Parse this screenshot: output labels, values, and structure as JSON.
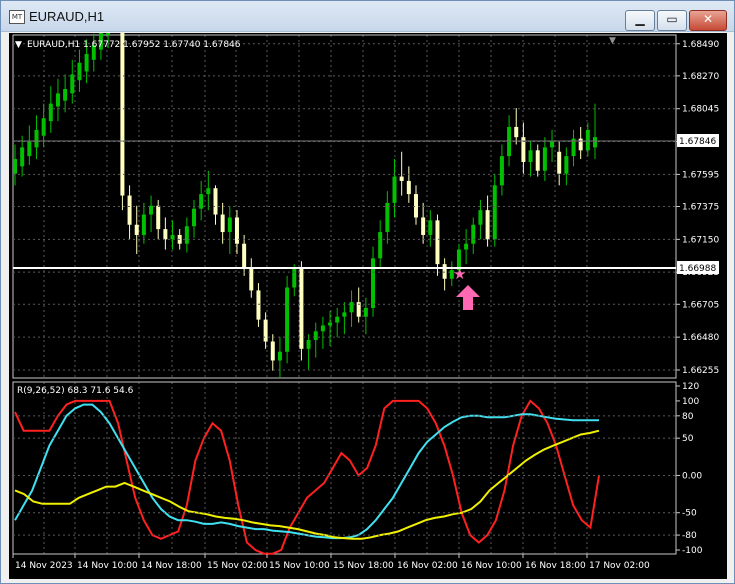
{
  "window": {
    "title": "EURAUD,H1",
    "icon_label": "MT",
    "minimize_glyph": "▁",
    "maximize_glyph": "▭",
    "close_glyph": "✕"
  },
  "price_panel": {
    "header": "EURAUD,H1  1.67772 1.67952 1.67740 1.67846",
    "y_ticks": [
      "1.68490",
      "1.68270",
      "1.68045",
      "1.67820",
      "1.67595",
      "1.67375",
      "1.67150",
      "1.66925",
      "1.66705",
      "1.66480",
      "1.66255"
    ],
    "current_price": "1.67846",
    "hline_price": "1.66988"
  },
  "indicator_panel": {
    "header": "R(9,26,52) 68.3 71.6 54.6",
    "y_ticks": [
      "120",
      "100",
      "80",
      "50",
      "0.00",
      "-50",
      "-80",
      "-100"
    ]
  },
  "x_axis": {
    "labels": [
      "14 Nov 2023",
      "14 Nov 10:00",
      "14 Nov 18:00",
      "15 Nov 02:00",
      "15 Nov 10:00",
      "15 Nov 18:00",
      "16 Nov 02:00",
      "16 Nov 10:00",
      "16 Nov 18:00",
      "17 Nov 02:00"
    ]
  },
  "colors": {
    "bull": "#00c000",
    "bear": "#ffffc0",
    "grid": "#5a5a5a",
    "red_line": "#ff2020",
    "cyan_line": "#40e0f0",
    "yellow_line": "#f0f000",
    "marker": "#ff69b4"
  },
  "chart_data": [
    {
      "type": "candlestick",
      "title": "EURAUD,H1",
      "ylim": [
        1.662,
        1.6855
      ],
      "candles": [
        {
          "o": 1.676,
          "h": 1.678,
          "l": 1.6752,
          "c": 1.677
        },
        {
          "o": 1.6765,
          "h": 1.6786,
          "l": 1.6758,
          "c": 1.6778
        },
        {
          "o": 1.6772,
          "h": 1.6793,
          "l": 1.6766,
          "c": 1.6782
        },
        {
          "o": 1.6778,
          "h": 1.68,
          "l": 1.677,
          "c": 1.679
        },
        {
          "o": 1.6786,
          "h": 1.6808,
          "l": 1.6778,
          "c": 1.6798
        },
        {
          "o": 1.6796,
          "h": 1.682,
          "l": 1.6788,
          "c": 1.6808
        },
        {
          "o": 1.6806,
          "h": 1.6825,
          "l": 1.6796,
          "c": 1.6815
        },
        {
          "o": 1.681,
          "h": 1.6828,
          "l": 1.6802,
          "c": 1.6818
        },
        {
          "o": 1.6815,
          "h": 1.6838,
          "l": 1.6808,
          "c": 1.6828
        },
        {
          "o": 1.6824,
          "h": 1.6845,
          "l": 1.6816,
          "c": 1.6836
        },
        {
          "o": 1.683,
          "h": 1.6852,
          "l": 1.6822,
          "c": 1.6842
        },
        {
          "o": 1.6838,
          "h": 1.6856,
          "l": 1.683,
          "c": 1.6848
        },
        {
          "o": 1.6845,
          "h": 1.687,
          "l": 1.6838,
          "c": 1.6858
        },
        {
          "o": 1.6855,
          "h": 1.6878,
          "l": 1.6846,
          "c": 1.6868
        },
        {
          "o": 1.6865,
          "h": 1.6888,
          "l": 1.6858,
          "c": 1.688
        },
        {
          "o": 1.688,
          "h": 1.6885,
          "l": 1.6735,
          "c": 1.6745
        },
        {
          "o": 1.6745,
          "h": 1.6752,
          "l": 1.6715,
          "c": 1.6725
        },
        {
          "o": 1.6725,
          "h": 1.6738,
          "l": 1.6705,
          "c": 1.6718
        },
        {
          "o": 1.6718,
          "h": 1.674,
          "l": 1.6712,
          "c": 1.6732
        },
        {
          "o": 1.6732,
          "h": 1.6745,
          "l": 1.672,
          "c": 1.6738
        },
        {
          "o": 1.6738,
          "h": 1.6742,
          "l": 1.6715,
          "c": 1.6722
        },
        {
          "o": 1.6722,
          "h": 1.673,
          "l": 1.6708,
          "c": 1.6715
        },
        {
          "o": 1.6715,
          "h": 1.6728,
          "l": 1.6708,
          "c": 1.6718
        },
        {
          "o": 1.6718,
          "h": 1.6722,
          "l": 1.6708,
          "c": 1.6712
        },
        {
          "o": 1.6712,
          "h": 1.673,
          "l": 1.6706,
          "c": 1.6724
        },
        {
          "o": 1.6724,
          "h": 1.6742,
          "l": 1.6716,
          "c": 1.6736
        },
        {
          "o": 1.6736,
          "h": 1.6755,
          "l": 1.6728,
          "c": 1.6746
        },
        {
          "o": 1.6746,
          "h": 1.6762,
          "l": 1.6735,
          "c": 1.675
        },
        {
          "o": 1.675,
          "h": 1.6752,
          "l": 1.6725,
          "c": 1.6732
        },
        {
          "o": 1.6732,
          "h": 1.674,
          "l": 1.6712,
          "c": 1.672
        },
        {
          "o": 1.672,
          "h": 1.6738,
          "l": 1.6705,
          "c": 1.673
        },
        {
          "o": 1.673,
          "h": 1.6735,
          "l": 1.6705,
          "c": 1.6712
        },
        {
          "o": 1.6712,
          "h": 1.6718,
          "l": 1.669,
          "c": 1.6695
        },
        {
          "o": 1.6695,
          "h": 1.6702,
          "l": 1.6675,
          "c": 1.668
        },
        {
          "o": 1.668,
          "h": 1.6685,
          "l": 1.6655,
          "c": 1.666
        },
        {
          "o": 1.666,
          "h": 1.6665,
          "l": 1.664,
          "c": 1.6645
        },
        {
          "o": 1.6645,
          "h": 1.665,
          "l": 1.6625,
          "c": 1.6632
        },
        {
          "o": 1.6632,
          "h": 1.6648,
          "l": 1.662,
          "c": 1.6638
        },
        {
          "o": 1.6638,
          "h": 1.669,
          "l": 1.663,
          "c": 1.6682
        },
        {
          "o": 1.6682,
          "h": 1.6698,
          "l": 1.6676,
          "c": 1.6695
        },
        {
          "o": 1.6695,
          "h": 1.67,
          "l": 1.6632,
          "c": 1.664
        },
        {
          "o": 1.664,
          "h": 1.665,
          "l": 1.6626,
          "c": 1.6646
        },
        {
          "o": 1.6646,
          "h": 1.6658,
          "l": 1.6634,
          "c": 1.6652
        },
        {
          "o": 1.6652,
          "h": 1.6662,
          "l": 1.664,
          "c": 1.6656
        },
        {
          "o": 1.6656,
          "h": 1.6666,
          "l": 1.6642,
          "c": 1.6658
        },
        {
          "o": 1.6658,
          "h": 1.6668,
          "l": 1.6648,
          "c": 1.6662
        },
        {
          "o": 1.6662,
          "h": 1.6672,
          "l": 1.665,
          "c": 1.6665
        },
        {
          "o": 1.6665,
          "h": 1.668,
          "l": 1.6655,
          "c": 1.6672
        },
        {
          "o": 1.6672,
          "h": 1.6682,
          "l": 1.6658,
          "c": 1.6662
        },
        {
          "o": 1.6662,
          "h": 1.6675,
          "l": 1.665,
          "c": 1.6668
        },
        {
          "o": 1.6668,
          "h": 1.671,
          "l": 1.6662,
          "c": 1.6702
        },
        {
          "o": 1.6702,
          "h": 1.6728,
          "l": 1.6695,
          "c": 1.672
        },
        {
          "o": 1.672,
          "h": 1.6748,
          "l": 1.6712,
          "c": 1.674
        },
        {
          "o": 1.674,
          "h": 1.677,
          "l": 1.673,
          "c": 1.6758
        },
        {
          "o": 1.6758,
          "h": 1.6775,
          "l": 1.6745,
          "c": 1.6755
        },
        {
          "o": 1.6755,
          "h": 1.6765,
          "l": 1.674,
          "c": 1.6746
        },
        {
          "o": 1.6746,
          "h": 1.6752,
          "l": 1.6725,
          "c": 1.673
        },
        {
          "o": 1.673,
          "h": 1.674,
          "l": 1.6712,
          "c": 1.6718
        },
        {
          "o": 1.6718,
          "h": 1.6735,
          "l": 1.671,
          "c": 1.6728
        },
        {
          "o": 1.6728,
          "h": 1.6732,
          "l": 1.669,
          "c": 1.6698
        },
        {
          "o": 1.6698,
          "h": 1.6702,
          "l": 1.668,
          "c": 1.6688
        },
        {
          "o": 1.6688,
          "h": 1.67,
          "l": 1.6683,
          "c": 1.6694
        },
        {
          "o": 1.6694,
          "h": 1.6712,
          "l": 1.669,
          "c": 1.6708
        },
        {
          "o": 1.6708,
          "h": 1.6722,
          "l": 1.6698,
          "c": 1.6712
        },
        {
          "o": 1.6712,
          "h": 1.673,
          "l": 1.6705,
          "c": 1.6725
        },
        {
          "o": 1.6725,
          "h": 1.6742,
          "l": 1.6715,
          "c": 1.6735
        },
        {
          "o": 1.6735,
          "h": 1.6745,
          "l": 1.671,
          "c": 1.6715
        },
        {
          "o": 1.6715,
          "h": 1.676,
          "l": 1.671,
          "c": 1.6752
        },
        {
          "o": 1.6752,
          "h": 1.678,
          "l": 1.6745,
          "c": 1.6772
        },
        {
          "o": 1.6772,
          "h": 1.68,
          "l": 1.6765,
          "c": 1.6792
        },
        {
          "o": 1.6792,
          "h": 1.6805,
          "l": 1.678,
          "c": 1.6785
        },
        {
          "o": 1.6785,
          "h": 1.6795,
          "l": 1.676,
          "c": 1.6768
        },
        {
          "o": 1.6768,
          "h": 1.6782,
          "l": 1.6758,
          "c": 1.6776
        },
        {
          "o": 1.6776,
          "h": 1.678,
          "l": 1.6758,
          "c": 1.6762
        },
        {
          "o": 1.6762,
          "h": 1.6785,
          "l": 1.6755,
          "c": 1.6778
        },
        {
          "o": 1.6778,
          "h": 1.679,
          "l": 1.6768,
          "c": 1.6782
        },
        {
          "o": 1.6775,
          "h": 1.6782,
          "l": 1.6752,
          "c": 1.676
        },
        {
          "o": 1.676,
          "h": 1.6778,
          "l": 1.6752,
          "c": 1.6772
        },
        {
          "o": 1.6772,
          "h": 1.679,
          "l": 1.6765,
          "c": 1.6784
        },
        {
          "o": 1.6784,
          "h": 1.6792,
          "l": 1.677,
          "c": 1.6776
        },
        {
          "o": 1.6776,
          "h": 1.6795,
          "l": 1.6772,
          "c": 1.679
        },
        {
          "o": 1.6778,
          "h": 1.6808,
          "l": 1.677,
          "c": 1.6785
        }
      ]
    },
    {
      "type": "line",
      "title": "R(9,26,52)",
      "ylim": [
        -100,
        120
      ],
      "series": [
        {
          "name": "R(9)",
          "values": [
            85,
            60,
            60,
            60,
            60,
            80,
            95,
            100,
            100,
            100,
            100,
            100,
            70,
            20,
            -30,
            -60,
            -80,
            -85,
            -80,
            -75,
            -40,
            20,
            50,
            70,
            60,
            20,
            -40,
            -90,
            -100,
            -105,
            -105,
            -100,
            -70,
            -50,
            -30,
            -20,
            -10,
            10,
            30,
            20,
            0,
            10,
            40,
            90,
            100,
            100,
            100,
            100,
            90,
            70,
            40,
            0,
            -50,
            -80,
            -90,
            -80,
            -60,
            -20,
            40,
            80,
            100,
            90,
            70,
            40,
            0,
            -40,
            -60,
            -70,
            0
          ]
        },
        {
          "name": "R(26)",
          "values": [
            -60,
            -40,
            -20,
            10,
            40,
            60,
            80,
            90,
            95,
            95,
            85,
            70,
            50,
            30,
            10,
            -10,
            -30,
            -45,
            -55,
            -60,
            -60,
            -62,
            -65,
            -65,
            -63,
            -65,
            -68,
            -70,
            -72,
            -72,
            -74,
            -75,
            -76,
            -78,
            -80,
            -82,
            -83,
            -84,
            -84,
            -83,
            -80,
            -72,
            -60,
            -45,
            -30,
            -10,
            10,
            30,
            45,
            55,
            65,
            72,
            78,
            80,
            80,
            78,
            78,
            78,
            80,
            82,
            82,
            80,
            78,
            76,
            75,
            74,
            74,
            74,
            74
          ]
        },
        {
          "name": "R(52)",
          "values": [
            -20,
            -25,
            -35,
            -38,
            -38,
            -38,
            -38,
            -30,
            -25,
            -20,
            -15,
            -15,
            -10,
            -15,
            -20,
            -25,
            -30,
            -35,
            -42,
            -48,
            -50,
            -52,
            -55,
            -57,
            -58,
            -60,
            -63,
            -65,
            -67,
            -68,
            -70,
            -72,
            -75,
            -78,
            -80,
            -83,
            -84,
            -85,
            -85,
            -83,
            -80,
            -78,
            -75,
            -70,
            -65,
            -60,
            -57,
            -55,
            -52,
            -50,
            -45,
            -35,
            -20,
            -10,
            0,
            10,
            20,
            28,
            35,
            40,
            45,
            50,
            55,
            57,
            60
          ]
        }
      ]
    }
  ]
}
